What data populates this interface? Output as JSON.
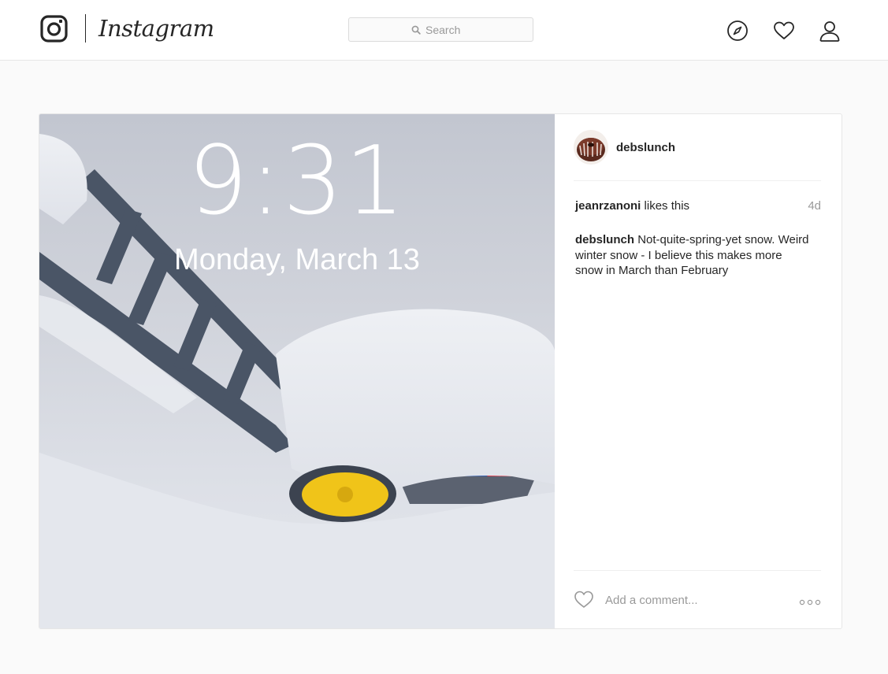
{
  "header": {
    "logo_text": "Instagram",
    "search_placeholder": "Search",
    "icons": [
      "instagram-glyph-icon",
      "search-icon",
      "explore-compass-icon",
      "activity-heart-icon",
      "profile-person-icon"
    ]
  },
  "post": {
    "photo": {
      "lock_time": "9:31",
      "lock_date": "Monday, March 13"
    },
    "author": "debslunch",
    "likes": {
      "user": "jeanrzanoni",
      "suffix": " likes this"
    },
    "age": "4d",
    "caption": {
      "user": "debslunch",
      "text": "Not-quite-spring-yet snow. Weird winter snow - I believe this makes more snow in March than February"
    },
    "comment_placeholder": "Add a comment...",
    "icons": [
      "avatar-bundt-cake-icon",
      "like-heart-icon",
      "more-options-icon"
    ]
  },
  "colors": {
    "background": "#fafafa",
    "border": "#e6e6e6",
    "text": "#262626",
    "muted": "#999999"
  }
}
